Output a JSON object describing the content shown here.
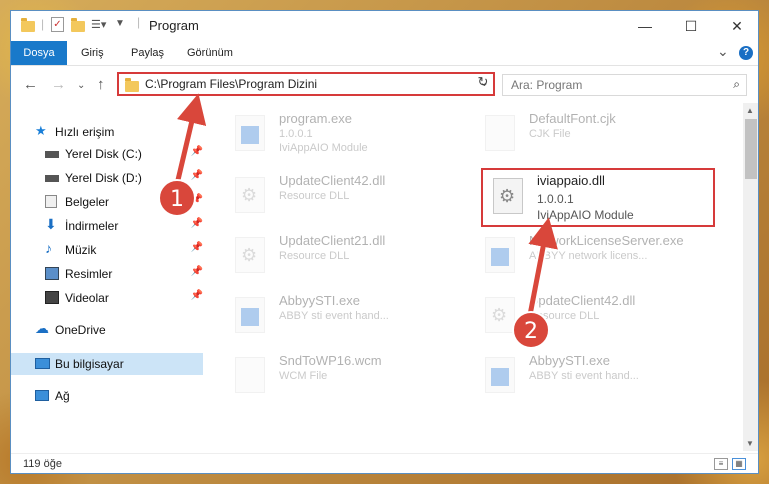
{
  "window": {
    "title": "Program",
    "minimize": "—",
    "maximize": "☐",
    "close": "✕"
  },
  "ribbon": {
    "tabs": [
      "Dosya",
      "Giriş",
      "Paylaş",
      "Görünüm"
    ],
    "expand": "⌄",
    "help": "?"
  },
  "address": {
    "path": "C:\\Program Files\\Program Dizini",
    "search_placeholder": "Ara: Program"
  },
  "nav": {
    "items": [
      {
        "label": "Hızlı erişim"
      },
      {
        "label": "Yerel Disk (C:)"
      },
      {
        "label": "Yerel Disk (D:)"
      },
      {
        "label": "Belgeler"
      },
      {
        "label": "İndirmeler"
      },
      {
        "label": "Müzik"
      },
      {
        "label": "Resimler"
      },
      {
        "label": "Videolar"
      },
      {
        "label": "OneDrive"
      },
      {
        "label": "Bu bilgisayar"
      },
      {
        "label": "Ağ"
      }
    ]
  },
  "files": [
    {
      "name": "program.exe",
      "line1": "1.0.0.1",
      "line2": "IviAppAIO Module"
    },
    {
      "name": "DefaultFont.cjk",
      "line1": "CJK File",
      "line2": ""
    },
    {
      "name": "UpdateClient42.dll",
      "line1": "Resource DLL",
      "line2": ""
    },
    {
      "name": "UpdateClient21.dll",
      "line1": "Resource DLL",
      "line2": ""
    },
    {
      "name": "NetworkLicenseServer.exe",
      "line1": "ABBYY network licens...",
      "line2": ""
    },
    {
      "name": "AbbyySTI.exe",
      "line1": "ABBY sti event hand...",
      "line2": ""
    },
    {
      "name": "UpdateClient42.dll",
      "line1": "Resource DLL",
      "line2": ""
    },
    {
      "name": "SndToWP16.wcm",
      "line1": "WCM File",
      "line2": ""
    },
    {
      "name": "AbbyySTI.exe",
      "line1": "ABBY sti event hand...",
      "line2": ""
    }
  ],
  "highlighted_file": {
    "name": "iviappaio.dll",
    "version": "1.0.0.1",
    "description": "IviAppAIO Module"
  },
  "status": {
    "count": "119 öğe"
  },
  "annotations": {
    "step1": "1",
    "step2": "2"
  }
}
